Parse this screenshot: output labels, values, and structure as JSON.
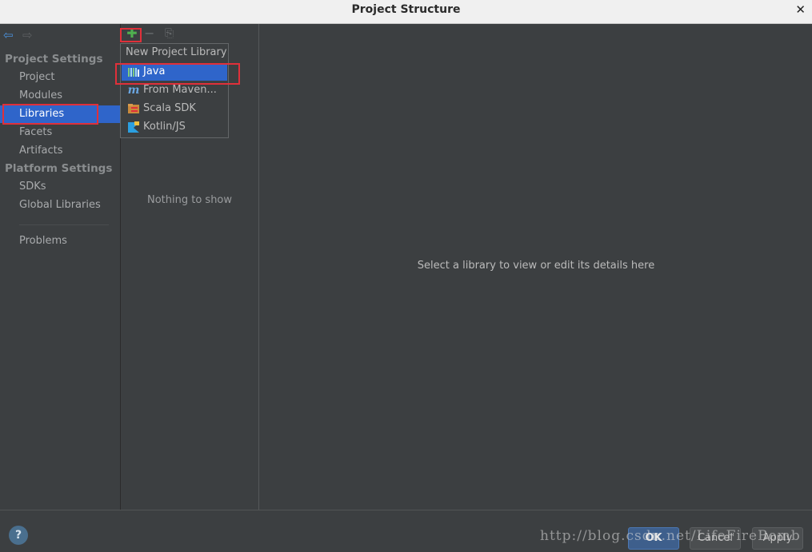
{
  "window": {
    "title": "Project Structure",
    "close_glyph": "✕"
  },
  "sidebar": {
    "back_icon": "arrow-left-icon",
    "forward_icon": "arrow-right-icon",
    "project_settings_header": "Project Settings",
    "platform_settings_header": "Platform Settings",
    "items": [
      {
        "label": "Project"
      },
      {
        "label": "Modules"
      },
      {
        "label": "Libraries",
        "selected": true
      },
      {
        "label": "Facets"
      },
      {
        "label": "Artifacts"
      }
    ],
    "platform_items": [
      {
        "label": "SDKs"
      },
      {
        "label": "Global Libraries"
      }
    ],
    "problems_label": "Problems"
  },
  "libraries_panel": {
    "toolbar": {
      "add_icon": "plus-icon",
      "remove_icon": "minus-icon",
      "copy_icon": "copy-icon"
    },
    "empty_text": "Nothing to show"
  },
  "popup": {
    "title": "New Project Library",
    "items": [
      {
        "label": "Java",
        "icon": "java-library-icon",
        "selected": true
      },
      {
        "label": "From Maven...",
        "icon": "maven-icon"
      },
      {
        "label": "Scala SDK",
        "icon": "scala-sdk-icon"
      },
      {
        "label": "Kotlin/JS",
        "icon": "kotlin-js-icon"
      }
    ]
  },
  "details": {
    "hint": "Select a library to view or edit its details here"
  },
  "footer": {
    "help_label": "?",
    "ok_label": "OK",
    "cancel_label": "Cancel",
    "apply_label": "Apply",
    "watermark": "http://blog.csdn.net/LifeFireBomb"
  },
  "colors": {
    "accent": "#2f65ca",
    "annotation_red": "#e0303a",
    "add_green": "#4fb04f"
  }
}
